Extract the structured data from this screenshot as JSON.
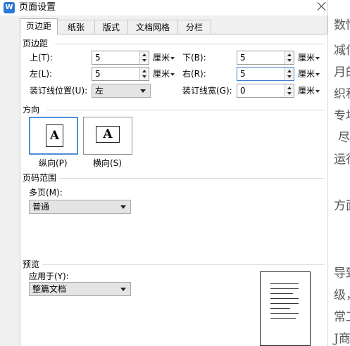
{
  "dialog": {
    "title": "页面设置",
    "app_icon": "W"
  },
  "tabs": [
    "页边距",
    "纸张",
    "版式",
    "文档网格",
    "分栏"
  ],
  "margins": {
    "section_title": "页边距",
    "top": {
      "label": "上(T):",
      "value": "5",
      "unit": "厘米"
    },
    "bottom": {
      "label": "下(B):",
      "value": "5",
      "unit": "厘米"
    },
    "left": {
      "label": "左(L):",
      "value": "5",
      "unit": "厘米"
    },
    "right": {
      "label": "右(R):",
      "value": "5",
      "unit": "厘米"
    },
    "gutter_pos": {
      "label": "装订线位置(U):",
      "value": "左"
    },
    "gutter": {
      "label": "装订线宽(G):",
      "value": "0",
      "unit": "厘米"
    }
  },
  "orientation": {
    "section_title": "方向",
    "portrait_label": "纵向(P)",
    "landscape_label": "横向(S)",
    "glyph": "A",
    "selected": "portrait"
  },
  "page_range": {
    "section_title": "页码范围",
    "multiple_label": "多页(M):",
    "multiple_value": "普通"
  },
  "preview": {
    "section_title": "预览",
    "apply_label": "应用于(Y):",
    "apply_value": "整篇文档"
  },
  "background_doc": [
    "数情",
    "减信",
    "月的",
    "织积",
    "专地",
    "尽",
    "运行",
    "方面",
    "导致",
    "级，",
    "常工",
    "J商"
  ],
  "icons": [
    "app-icon",
    "close-icon",
    "spin-up-icon",
    "spin-down-icon",
    "dropdown-arrow-icon",
    "page-preview-icon"
  ],
  "colors": {
    "focus_border": "#3c7fd3",
    "selected_orientation": "#4a90d9",
    "dialog_bg": "#f0f0f0"
  }
}
